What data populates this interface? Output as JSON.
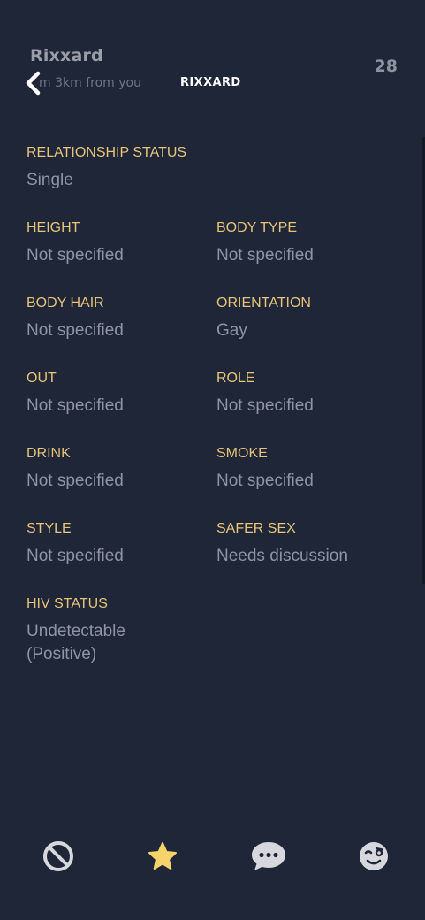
{
  "header": {
    "name": "Rixxard",
    "distance": "m 3km from you",
    "title": "RIXXARD",
    "age": "28",
    "back_icon": "chevron-left-icon"
  },
  "profile": {
    "relationship": {
      "label": "RELATIONSHIP STATUS",
      "value": "Single"
    },
    "height": {
      "label": "HEIGHT",
      "value": "Not specified"
    },
    "body_type": {
      "label": "BODY TYPE",
      "value": "Not specified"
    },
    "body_hair": {
      "label": "BODY HAIR",
      "value": "Not specified"
    },
    "orientation": {
      "label": "ORIENTATION",
      "value": "Gay"
    },
    "out": {
      "label": "OUT",
      "value": "Not specified"
    },
    "role": {
      "label": "ROLE",
      "value": "Not specified"
    },
    "drink": {
      "label": "DRINK",
      "value": "Not specified"
    },
    "smoke": {
      "label": "SMOKE",
      "value": "Not specified"
    },
    "style": {
      "label": "STYLE",
      "value": "Not specified"
    },
    "safer_sex": {
      "label": "SAFER SEX",
      "value": "Needs discussion"
    },
    "hiv_status": {
      "label": "HIV STATUS",
      "value": "Undetectable (Positive)"
    }
  },
  "bottom_nav": {
    "block_icon": "block-icon",
    "favorite_icon": "star-icon",
    "chat_icon": "chat-bubble-icon",
    "tap_icon": "wink-face-icon"
  },
  "colors": {
    "background": "#1f2638",
    "label": "#e7c478",
    "value": "#8e94a2",
    "star": "#f6d46b"
  }
}
